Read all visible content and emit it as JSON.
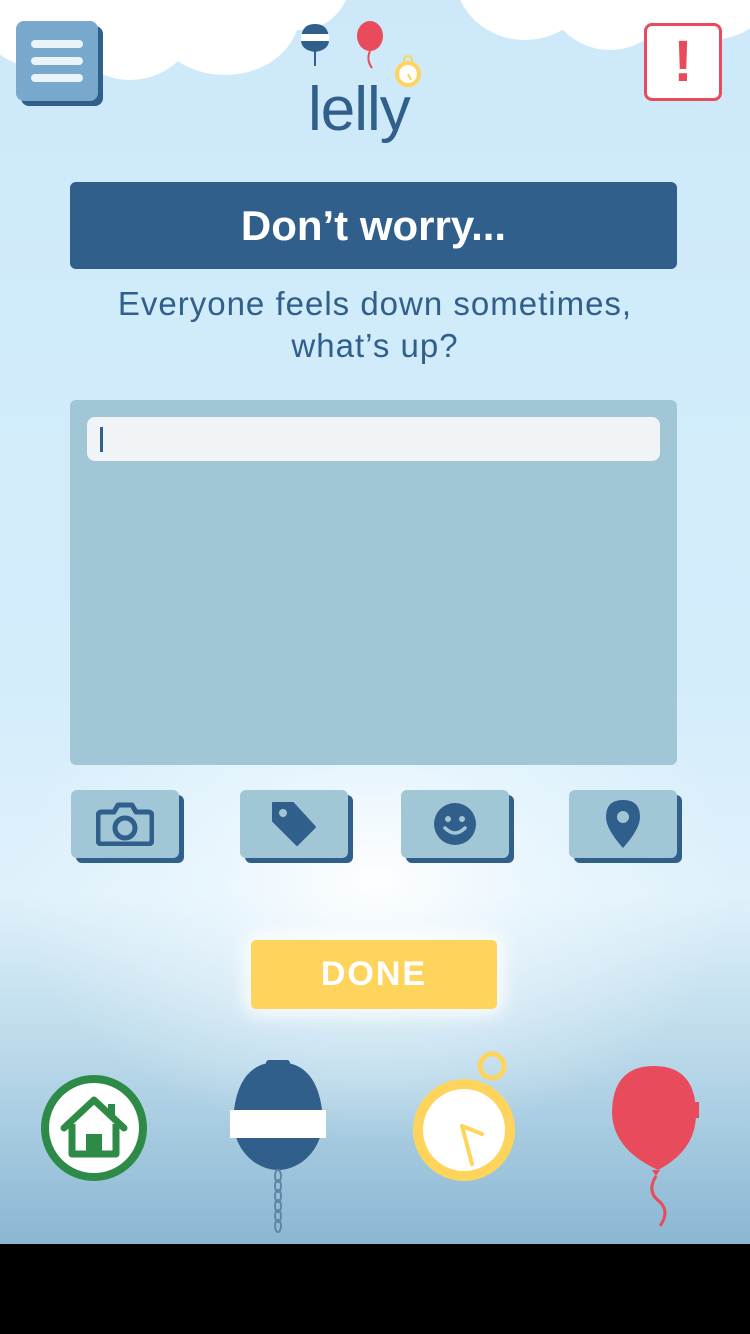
{
  "app": {
    "logo_text": "lelly"
  },
  "header": {
    "alert_label": "!"
  },
  "main": {
    "title": "Don’t worry...",
    "subtitle_line1": "Everyone feels down sometimes,",
    "subtitle_line2": "what’s up?",
    "note_input": {
      "value": "",
      "placeholder": ""
    },
    "attachments": [
      {
        "icon": "camera-icon"
      },
      {
        "icon": "tag-icon"
      },
      {
        "icon": "smiley-icon"
      },
      {
        "icon": "location-pin-icon"
      }
    ],
    "done_label": "DONE"
  },
  "bottom_nav": [
    {
      "icon": "home-icon"
    },
    {
      "icon": "buoy-icon"
    },
    {
      "icon": "stopwatch-icon"
    },
    {
      "icon": "balloon-icon"
    }
  ],
  "colors": {
    "primary": "#2f5f8a",
    "accent_yellow": "#ffd45c",
    "alert_red": "#e84c5c",
    "home_green": "#2e8b47",
    "panel": "#a1c6d6",
    "sky": "#cde9f9"
  }
}
